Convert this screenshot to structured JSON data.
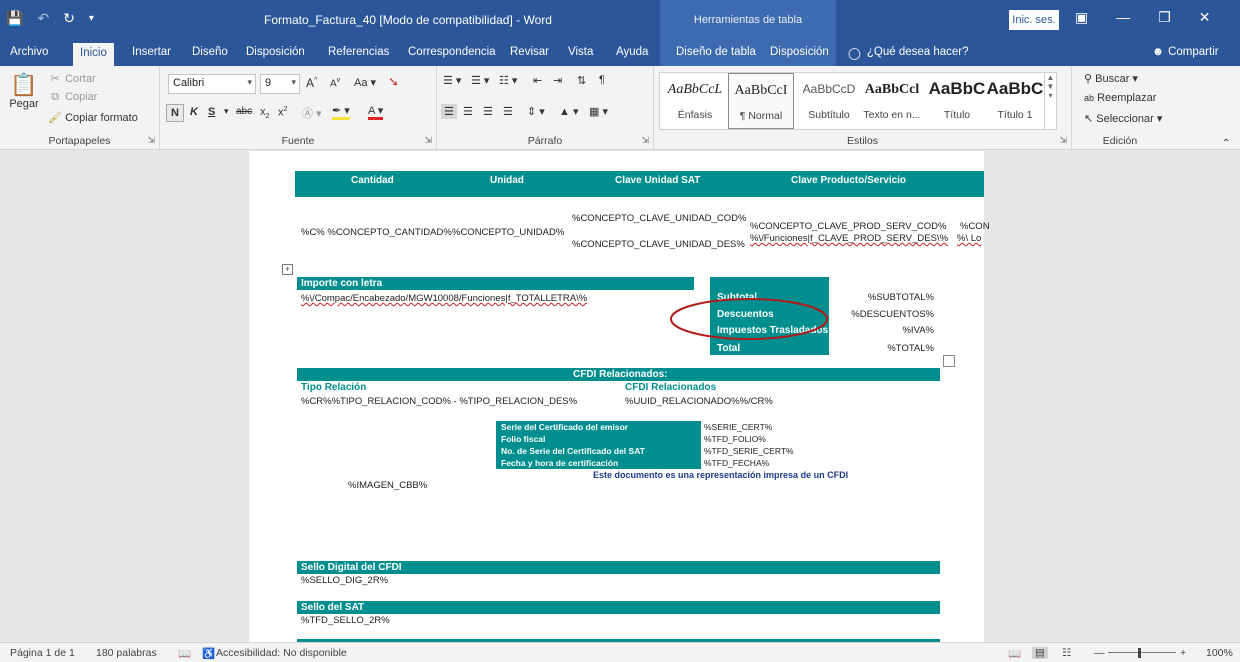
{
  "titlebar": {
    "document_title": "Formato_Factura_40 [Modo de compatibilidad] - Word",
    "context_title": "Herramientas de tabla",
    "signin_label": "Inic. ses."
  },
  "tabs": {
    "file": "Archivo",
    "home": "Inicio",
    "insert": "Insertar",
    "design": "Diseño",
    "layout": "Disposición",
    "references": "Referencias",
    "mailings": "Correspondencia",
    "review": "Revisar",
    "view": "Vista",
    "help": "Ayuda",
    "table_design": "Diseño de tabla",
    "table_layout": "Disposición",
    "tell_me": "¿Qué desea hacer?",
    "share": "Compartir"
  },
  "ribbon": {
    "clipboard": {
      "label": "Portapapeles",
      "paste": "Pegar",
      "cut": "Cortar",
      "copy": "Copiar",
      "format_painter": "Copiar formato"
    },
    "font": {
      "label": "Fuente",
      "font_name": "Calibri",
      "font_size": "9",
      "bold": "N",
      "italic": "K",
      "underline": "S"
    },
    "paragraph": {
      "label": "Párrafo"
    },
    "styles": {
      "label": "Estilos",
      "items": [
        {
          "sample": "AaBbCcL",
          "name": "Énfasis"
        },
        {
          "sample": "AaBbCcI",
          "name": "¶ Normal"
        },
        {
          "sample": "AaBbCcD",
          "name": "Subtítulo"
        },
        {
          "sample": "AaBbCcl",
          "name": "Texto en n..."
        },
        {
          "sample": "AaBbC",
          "name": "Título"
        },
        {
          "sample": "AaBbC",
          "name": "Título 1"
        }
      ]
    },
    "editing": {
      "label": "Edición",
      "find": "Buscar",
      "replace": "Reemplazar",
      "select": "Seleccionar"
    }
  },
  "document": {
    "table_headers": [
      "Cantidad",
      "Unidad",
      "Clave Unidad SAT",
      "Clave Producto/Servicio"
    ],
    "concept_qty": "%C% %CONCEPTO_CANTIDAD%",
    "concept_unit": "%CONCEPTO_UNIDAD%",
    "concept_clave_unidad_cod": "%CONCEPTO_CLAVE_UNIDAD_COD%",
    "concept_clave_unidad_des": "%CONCEPTO_CLAVE_UNIDAD_DES%",
    "concept_prod_serv_cod": "%CONCEPTO_CLAVE_PROD_SERV_COD%",
    "concept_prod_serv_des": "%\\/Funciones|f_CLAVE_PROD_SERV_DES\\%",
    "concept_clipped_1": "%CON",
    "concept_clipped_2": "%\\ Lo",
    "importe_label": "Importe con letra",
    "importe_value": "%\\/Compac/Encabezado/MGW10008/Funciones|f_TOTALLETRA\\%",
    "totals": [
      {
        "label": "Subtotal",
        "value": "%SUBTOTAL%"
      },
      {
        "label": "Descuentos",
        "value": "%DESCUENTOS%"
      },
      {
        "label": "Impuestos Trasladados",
        "value": "%IVA%"
      },
      {
        "label": "Total",
        "value": "%TOTAL%"
      }
    ],
    "cfdi_title": "CFDI Relacionados:",
    "tipo_relacion_label": "Tipo Relación",
    "tipo_relacion_value": "%CR%%TIPO_RELACION_COD% - %TIPO_RELACION_DES%",
    "cfdi_relacionados_label": "CFDI Relacionados",
    "cfdi_relacionados_value": "%UUID_RELACIONADO%%/CR%",
    "cert": [
      {
        "label": "Serie del Certificado del emisor",
        "value": "%SERIE_CERT%"
      },
      {
        "label": "Folio fiscal",
        "value": "%TFD_FOLIO%"
      },
      {
        "label": "No. de Serie del Certificado del SAT",
        "value": "%TFD_SERIE_CERT%"
      },
      {
        "label": "Fecha y hora de certificación",
        "value": "%TFD_FECHA%"
      }
    ],
    "representation_note": "Este documento es una representación impresa de un CFDI",
    "image_cbb": "%IMAGEN_CBB%",
    "sello_cfdi_label": "Sello Digital del CFDI",
    "sello_cfdi_value": "%SELLO_DIG_2R%",
    "sello_sat_label": "Sello del SAT",
    "sello_sat_value": "%TFD_SELLO_2R%"
  },
  "statusbar": {
    "page": "Página 1 de 1",
    "words": "180 palabras",
    "accessibility": "Accesibilidad: No disponible",
    "zoom": "100%"
  },
  "colors": {
    "word_blue": "#2b579a",
    "table_teal": "#008e8e",
    "annotation_red": "#b01c1c"
  }
}
